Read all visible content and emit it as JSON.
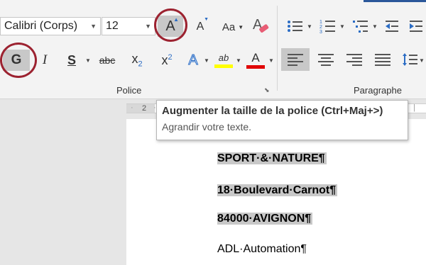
{
  "ribbon": {
    "font_name": "Calibri (Corps)",
    "font_size": "12",
    "police_label": "Police",
    "paragraphe_label": "Paragraphe",
    "aa_label": "Aa",
    "bold": "G",
    "italic": "I",
    "underline": "S",
    "strike": "abc",
    "sub": "x",
    "sub_digit": "2",
    "sup": "x",
    "sup_digit": "2",
    "grow_font": "A",
    "shrink_font": "A",
    "text_effect": "A",
    "highlight": "ab",
    "font_color": "A",
    "highlight_color": "#ffff00",
    "font_color_value": "#e00000"
  },
  "ruler": {
    "mark": "2"
  },
  "tooltip": {
    "title": "Augmenter la taille de la police (Ctrl+Maj+>)",
    "description": "Agrandir votre texte."
  },
  "document": {
    "lines": [
      "SPORT·&·NATURE¶",
      "18·Boulevard·Carnot¶",
      "84000·AVIGNON¶",
      "ADL·Automation¶"
    ]
  }
}
